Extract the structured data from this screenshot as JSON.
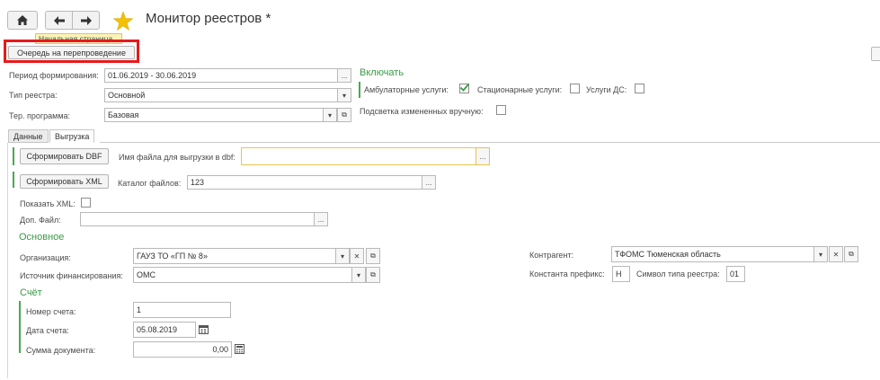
{
  "header": {
    "title": "Монитор реестров *",
    "tooltip": "Начальная страница",
    "requeue_button": "Очередь на перепроведение"
  },
  "period": {
    "label": "Период формирования:",
    "value": "01.06.2019 - 30.06.2019",
    "pick": "..."
  },
  "registry_type": {
    "label": "Тип реестра:",
    "value": "Основной"
  },
  "ter_program": {
    "label": "Тер. программа:",
    "value": "Базовая"
  },
  "include": {
    "title": "Включать",
    "ambulatory": {
      "label": "Амбулаторные услуги:",
      "checked": true
    },
    "inpatient": {
      "label": "Стационарные услуги:",
      "checked": false
    },
    "day_care": {
      "label": "Услуги ДС:",
      "checked": false
    },
    "highlight": {
      "label": "Подсветка измененных вручную:",
      "checked": false
    }
  },
  "tabs": [
    {
      "label": "Данные",
      "active": false
    },
    {
      "label": "Выгрузка",
      "active": true
    }
  ],
  "export": {
    "dbf_button": "Сформировать DBF",
    "dbf_file_label": "Имя файла для выгрузки в dbf:",
    "dbf_file_value": "",
    "xml_button": "Сформировать XML",
    "catalog_label": "Каталог файлов:",
    "catalog_value": "123",
    "show_xml_label": "Показать XML:",
    "extra_file_label": "Доп. Файл:",
    "extra_file_value": ""
  },
  "main": {
    "title": "Основное",
    "org_label": "Организация:",
    "org_value": "ГАУЗ ТО «ГП № 8»",
    "funding_label": "Источник финансирования:",
    "funding_value": "ОМС",
    "contractor_label": "Контрагент:",
    "contractor_value": "ТФОМС Тюменская область",
    "prefix_label": "Константа префикс:",
    "prefix_value": "Н",
    "reg_type_symbol_label": "Символ типа реестра:",
    "reg_type_symbol_value": "01"
  },
  "invoice": {
    "title": "Счёт",
    "number_label": "Номер счета:",
    "number_value": "1",
    "date_label": "Дата счета:",
    "date_value": "05.08.2019",
    "sum_label": "Сумма документа:",
    "sum_value": "0,00"
  },
  "colors": {
    "accent_green": "#3a9a45",
    "highlight_red": "#e8191b",
    "star": "#f2c200"
  }
}
